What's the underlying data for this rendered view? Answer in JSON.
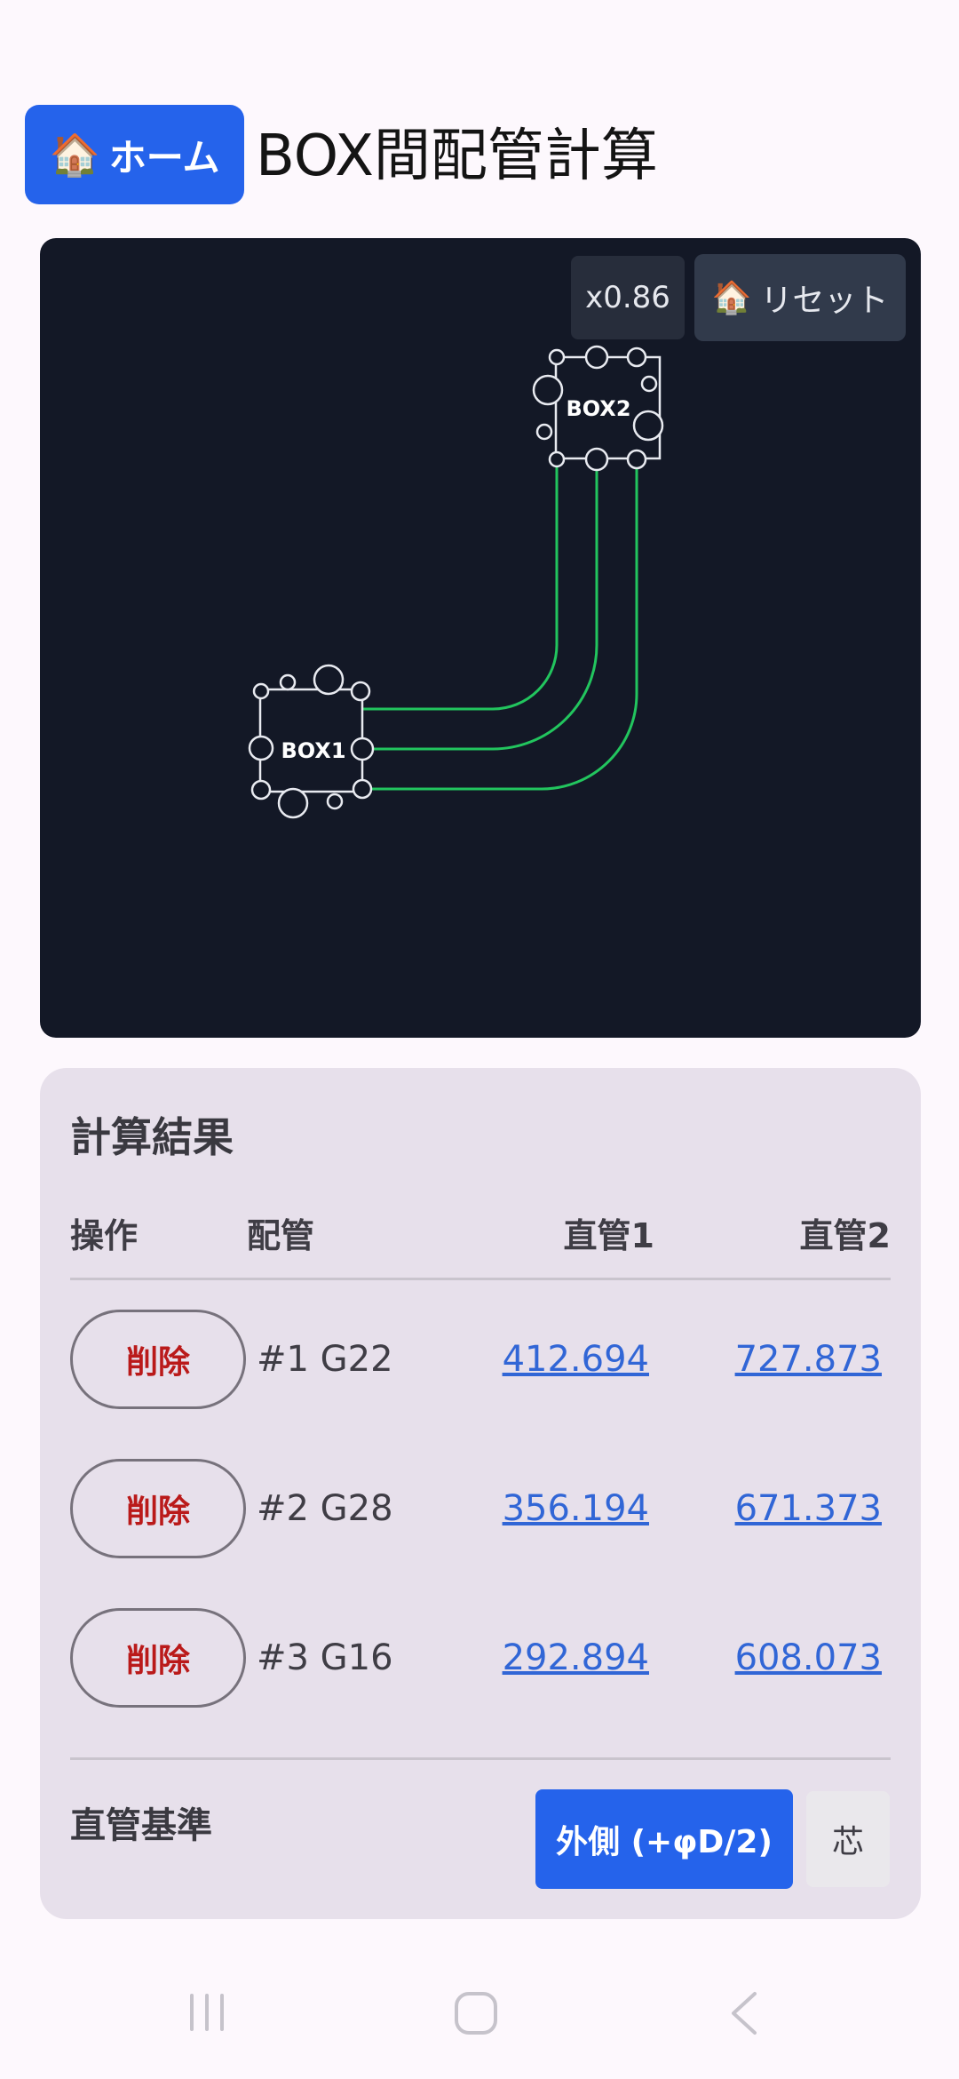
{
  "header": {
    "home_label": "ホーム",
    "title": "BOX間配管計算"
  },
  "canvas": {
    "zoom": "x0.86",
    "reset_label": "リセット",
    "boxes": [
      {
        "label": "BOX1"
      },
      {
        "label": "BOX2"
      }
    ],
    "pipe_color": "#22c55e",
    "background": "#131826"
  },
  "results": {
    "title": "計算結果",
    "columns": {
      "operation": "操作",
      "pipe": "配管",
      "straight1": "直管1",
      "straight2": "直管2"
    },
    "rows": [
      {
        "delete_label": "削除",
        "pipe": "#1 G22",
        "straight1": "412.694",
        "straight2": "727.873"
      },
      {
        "delete_label": "削除",
        "pipe": "#2 G28",
        "straight1": "356.194",
        "straight2": "671.373"
      },
      {
        "delete_label": "削除",
        "pipe": "#3 G16",
        "straight1": "292.894",
        "straight2": "608.073"
      }
    ],
    "basis": {
      "label": "直管基準",
      "outer_label": "外側 (+φD/2)",
      "core_label": "芯",
      "selected": "outer"
    }
  },
  "colors": {
    "accent": "#2563eb",
    "danger": "#ba1a1a",
    "link": "#3166d6"
  }
}
